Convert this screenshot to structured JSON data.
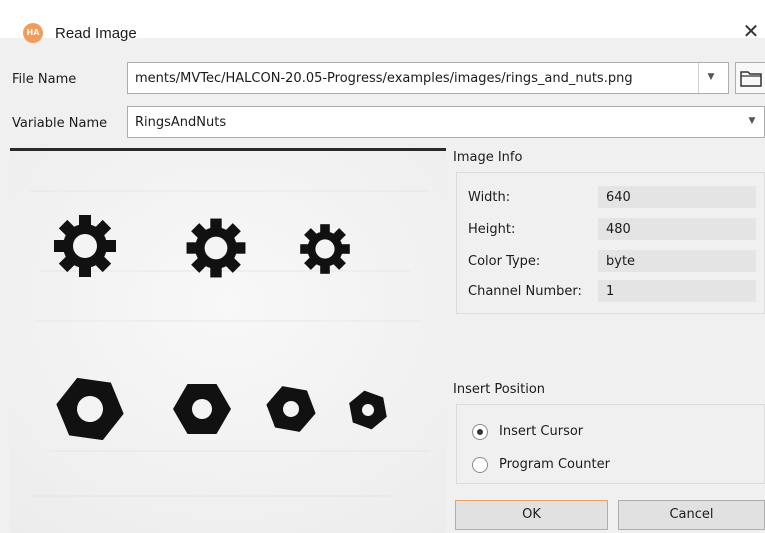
{
  "window": {
    "title": "Read Image",
    "app_icon_text": "HA"
  },
  "file_name": {
    "label": "File Name",
    "value": "ments/MVTec/HALCON-20.05-Progress/examples/images/rings_and_nuts.png"
  },
  "variable_name": {
    "label": "Variable Name",
    "value": "RingsAndNuts"
  },
  "image_info": {
    "title": "Image Info",
    "rows": [
      {
        "key": "Width:",
        "value": "640"
      },
      {
        "key": "Height:",
        "value": "480"
      },
      {
        "key": "Color Type:",
        "value": "byte"
      },
      {
        "key": "Channel Number:",
        "value": "1"
      }
    ]
  },
  "insert_position": {
    "title": "Insert Position",
    "options": [
      {
        "label": "Insert Cursor",
        "selected": true
      },
      {
        "label": "Program Counter",
        "selected": false
      }
    ]
  },
  "buttons": {
    "ok": "OK",
    "cancel": "Cancel"
  },
  "icons": {
    "close": "close-icon",
    "folder": "folder-icon",
    "dropdown": "chevron-down-icon"
  }
}
